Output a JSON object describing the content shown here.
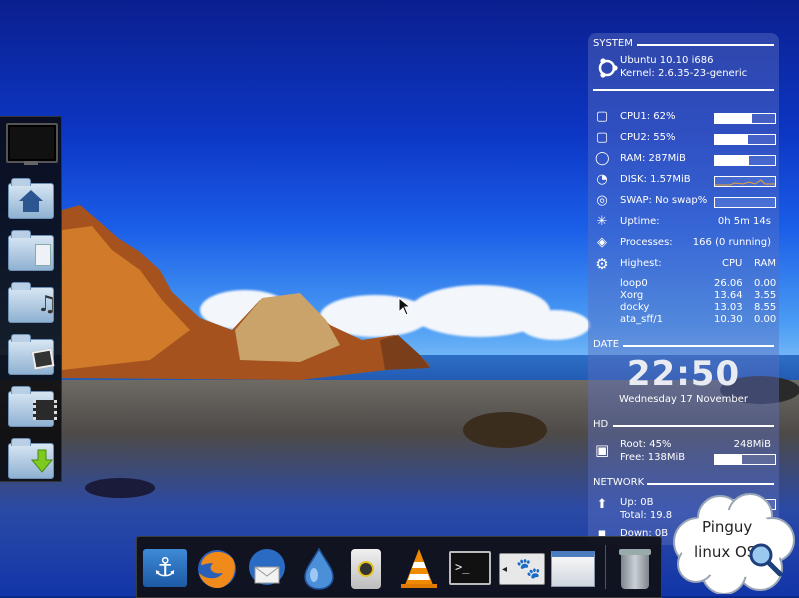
{
  "conky": {
    "system": {
      "header": "SYSTEM",
      "os": "Ubuntu 10.10 i686",
      "kernel": "Kernel: 2.6.35-23-generic"
    },
    "stats": [
      {
        "icon": "cpu-icon",
        "label": "CPU1: 62%",
        "fill": 0.62
      },
      {
        "icon": "cpu-icon",
        "label": "CPU2: 55%",
        "fill": 0.55
      },
      {
        "icon": "ram-icon",
        "label": "RAM: 287MiB",
        "fill": 0.56
      },
      {
        "icon": "disk-icon",
        "label": "DISK: 1.57MiB",
        "fill": 0
      },
      {
        "icon": "swap-icon",
        "label": "SWAP: No swap%",
        "fill": 0
      }
    ],
    "uptime": {
      "label": "Uptime:",
      "value": "0h 5m 14s"
    },
    "processes": {
      "label": "Processes:",
      "value": "166 (0 running)"
    },
    "highest": {
      "label": "Highest:",
      "col_cpu": "CPU",
      "col_ram": "RAM",
      "rows": [
        {
          "name": "loop0",
          "cpu": "26.06",
          "ram": "0.00"
        },
        {
          "name": "Xorg",
          "cpu": "13.64",
          "ram": "3.55"
        },
        {
          "name": "docky",
          "cpu": "13.03",
          "ram": "8.55"
        },
        {
          "name": "ata_sff/1",
          "cpu": "10.30",
          "ram": "0.00"
        }
      ]
    },
    "date": {
      "header": "DATE",
      "time": "22:50",
      "day": "Wednesday 17 November"
    },
    "hd": {
      "header": "HD",
      "root_label": "Root: 45%",
      "root_size": "248MiB",
      "free_label": "Free: 138MiB",
      "fill": 0.45
    },
    "network": {
      "header": "NETWORK",
      "up": "Up: 0B",
      "total": "Total: 19.8",
      "down": "Down: 0B"
    }
  },
  "badge": {
    "line1": "Pinguy",
    "line2": "linux OS"
  },
  "launcher": [
    "monitor-icon",
    "home-folder-icon",
    "documents-folder-icon",
    "music-folder-icon",
    "pictures-folder-icon",
    "videos-folder-icon",
    "downloads-folder-icon"
  ],
  "dock": [
    "anchor-icon",
    "firefox-icon",
    "thunderbird-icon",
    "deluge-icon",
    "speaker-icon",
    "vlc-icon",
    "terminal-icon",
    "gimp-icon",
    "window-icon",
    "trash-icon"
  ]
}
